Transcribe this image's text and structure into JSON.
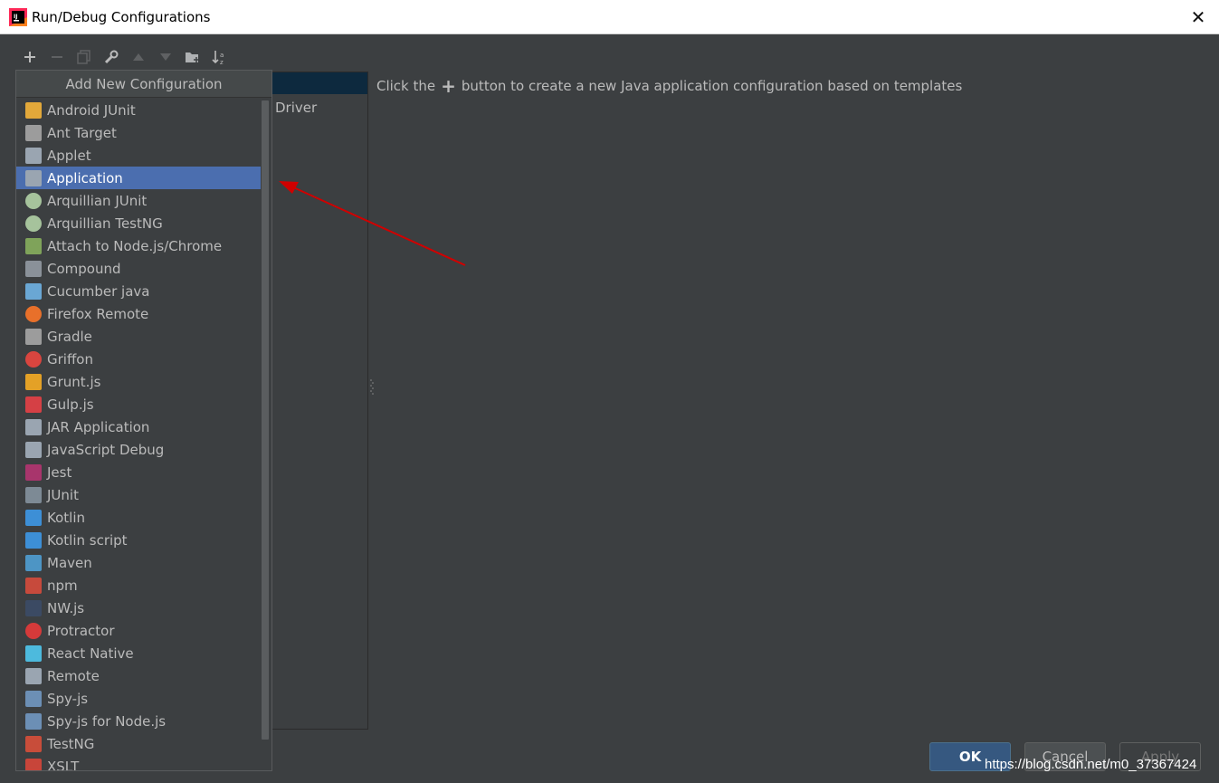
{
  "window": {
    "title": "Run/Debug Configurations",
    "close_glyph": "✕"
  },
  "toolbar": {
    "buttons": [
      {
        "name": "add-icon",
        "glyph": "+"
      },
      {
        "name": "remove-icon",
        "glyph": "−"
      },
      {
        "name": "copy-icon",
        "glyph": "⧉"
      },
      {
        "name": "wrench-icon",
        "glyph": "🔧"
      },
      {
        "name": "move-up-icon",
        "glyph": "▲"
      },
      {
        "name": "move-down-icon",
        "glyph": "▼"
      },
      {
        "name": "new-folder-icon",
        "glyph": "📁"
      },
      {
        "name": "sort-icon",
        "glyph": "↓a"
      }
    ]
  },
  "left_panel": {
    "partial_text": "Driver"
  },
  "hint": {
    "before": "Click the",
    "plus_glyph": "+",
    "after": "button to create a new Java application configuration based on templates"
  },
  "popup": {
    "title": "Add New Configuration",
    "selected_index": 3,
    "items": [
      {
        "label": "Android JUnit",
        "icon": "android-junit-icon",
        "color": "#e2a83a"
      },
      {
        "label": "Ant Target",
        "icon": "ant-icon",
        "color": "#9c9c9c"
      },
      {
        "label": "Applet",
        "icon": "applet-icon",
        "color": "#9aa5b1"
      },
      {
        "label": "Application",
        "icon": "application-icon",
        "color": "#9aa5b1"
      },
      {
        "label": "Arquillian JUnit",
        "icon": "arquillian-icon",
        "color": "#a6c39c"
      },
      {
        "label": "Arquillian TestNG",
        "icon": "arquillian-icon",
        "color": "#a6c39c"
      },
      {
        "label": "Attach to Node.js/Chrome",
        "icon": "nodejs-attach-icon",
        "color": "#7fa35a"
      },
      {
        "label": "Compound",
        "icon": "compound-icon",
        "color": "#8a9199"
      },
      {
        "label": "Cucumber java",
        "icon": "cucumber-icon",
        "color": "#6aa7d4"
      },
      {
        "label": "Firefox Remote",
        "icon": "firefox-icon",
        "color": "#e8702a"
      },
      {
        "label": "Gradle",
        "icon": "gradle-icon",
        "color": "#9c9c9c"
      },
      {
        "label": "Griffon",
        "icon": "griffon-icon",
        "color": "#d9453f"
      },
      {
        "label": "Grunt.js",
        "icon": "grunt-icon",
        "color": "#e4a126"
      },
      {
        "label": "Gulp.js",
        "icon": "gulp-icon",
        "color": "#d54045"
      },
      {
        "label": "JAR Application",
        "icon": "jar-icon",
        "color": "#9aa5b1"
      },
      {
        "label": "JavaScript Debug",
        "icon": "js-debug-icon",
        "color": "#9aa5b1"
      },
      {
        "label": "Jest",
        "icon": "jest-icon",
        "color": "#a8356c"
      },
      {
        "label": "JUnit",
        "icon": "junit-icon",
        "color": "#7d8a95"
      },
      {
        "label": "Kotlin",
        "icon": "kotlin-icon",
        "color": "#3d8fd6"
      },
      {
        "label": "Kotlin script",
        "icon": "kotlin-icon",
        "color": "#3d8fd6"
      },
      {
        "label": "Maven",
        "icon": "maven-icon",
        "color": "#4d95c5"
      },
      {
        "label": "npm",
        "icon": "npm-icon",
        "color": "#c74a3c"
      },
      {
        "label": "NW.js",
        "icon": "nwjs-icon",
        "color": "#3b4a63"
      },
      {
        "label": "Protractor",
        "icon": "protractor-icon",
        "color": "#d53a3a"
      },
      {
        "label": "React Native",
        "icon": "react-icon",
        "color": "#4dbadd"
      },
      {
        "label": "Remote",
        "icon": "remote-icon",
        "color": "#9aa5b1"
      },
      {
        "label": "Spy-js",
        "icon": "spyjs-icon",
        "color": "#6c8fb5"
      },
      {
        "label": "Spy-js for Node.js",
        "icon": "spyjs-node-icon",
        "color": "#6c8fb5"
      },
      {
        "label": "TestNG",
        "icon": "testng-icon",
        "color": "#c84d3a"
      },
      {
        "label": "XSLT",
        "icon": "xslt-icon",
        "color": "#c8453a"
      }
    ]
  },
  "buttons": {
    "ok": "OK",
    "cancel": "Cancel",
    "apply": "Apply"
  },
  "watermark": "https://blog.csdn.net/m0_37367424",
  "colors": {
    "selection": "#4b6eaf",
    "background": "#3c3f41",
    "arrow": "#d00000"
  }
}
